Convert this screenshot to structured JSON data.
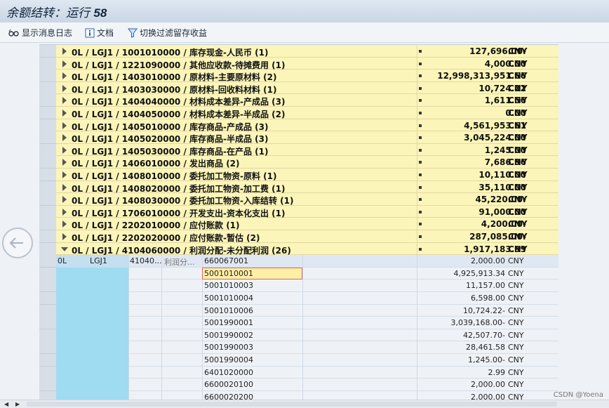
{
  "title": {
    "prefix": "余额结转：运行 ",
    "run": "58"
  },
  "toolbar": [
    {
      "label": "显示消息日志",
      "icon": "glasses-icon"
    },
    {
      "label": "文档",
      "icon": "info-icon"
    },
    {
      "label": "切换过滤留存收益",
      "icon": "filter-icon"
    }
  ],
  "groups": [
    {
      "text": "0L / LGJ1 / 1001010000 / 库存现金-人民币 (1)",
      "amount": "127,696.00-",
      "currency": "CNY"
    },
    {
      "text": "0L / LGJ1 / 1221090000 / 其他应收款-待摊费用 (1)",
      "amount": "4,000.00",
      "currency": "CNY"
    },
    {
      "text": "0L / LGJ1 / 1403010000 / 原材料-主要原材料 (2)",
      "amount": "12,998,313,951.66",
      "currency": "CNY"
    },
    {
      "text": "0L / LGJ1 / 1403030000 / 原材料-回收料材料 (1)",
      "amount": "10,724.22",
      "currency": "CNY"
    },
    {
      "text": "0L / LGJ1 / 1404040000 / 材料成本差异-产成品 (3)",
      "amount": "1,611.56",
      "currency": "CNY"
    },
    {
      "text": "0L / LGJ1 / 1404050000 / 材料成本差异-半成品 (2)",
      "amount": "0.00",
      "currency": "CNY"
    },
    {
      "text": "0L / LGJ1 / 1405010000 / 库存商品-产成品 (3)",
      "amount": "4,561,953.61",
      "currency": "CNY"
    },
    {
      "text": "0L / LGJ1 / 1405020000 / 库存商品-半成品 (3)",
      "amount": "3,045,224.00",
      "currency": "CNY"
    },
    {
      "text": "0L / LGJ1 / 1405030000 / 库存商品-在产品 (1)",
      "amount": "1,245.00",
      "currency": "CNY"
    },
    {
      "text": "0L / LGJ1 / 1406010000 / 发出商品 (2)",
      "amount": "7,686.96",
      "currency": "CNY"
    },
    {
      "text": "0L / LGJ1 / 1408010000 / 委托加工物资-原料 (1)",
      "amount": "10,110.00",
      "currency": "CNY"
    },
    {
      "text": "0L / LGJ1 / 1408020000 / 委托加工物资-加工费 (1)",
      "amount": "35,110.00",
      "currency": "CNY"
    },
    {
      "text": "0L / LGJ1 / 1408030000 / 委托加工物资-入库结转 (1)",
      "amount": "45,220.00-",
      "currency": "CNY"
    },
    {
      "text": "0L / LGJ1 / 1706010000 / 开发支出-资本化支出 (1)",
      "amount": "91,000.00",
      "currency": "CNY"
    },
    {
      "text": "0L / LGJ1 / 2202010000 / 应付账款 (1)",
      "amount": "4,200.00-",
      "currency": "CNY"
    },
    {
      "text": "0L / LGJ1 / 2202020000 / 应付账款-暂估 (2)",
      "amount": "287,085.00-",
      "currency": "CNY"
    },
    {
      "text": "0L / LGJ1 / 4104060000 / 利润分配-未分配利润 (26)",
      "amount": "1,917,183.99",
      "currency": "CNY",
      "expanded": true
    }
  ],
  "detail_head": {
    "ledger": "0L",
    "company": "LGJ1",
    "account": "41040...",
    "name": "利润分..."
  },
  "details": [
    {
      "account": "660067001",
      "amount": "2,000.00",
      "currency": "CNY"
    },
    {
      "account": "5001010001",
      "amount": "4,925,913.34",
      "currency": "CNY",
      "selected": true
    },
    {
      "account": "5001010003",
      "amount": "11,157.00",
      "currency": "CNY"
    },
    {
      "account": "5001010004",
      "amount": "6,598.00",
      "currency": "CNY"
    },
    {
      "account": "5001010006",
      "amount": "10,724.22-",
      "currency": "CNY"
    },
    {
      "account": "5001990001",
      "amount": "3,039,168.00-",
      "currency": "CNY"
    },
    {
      "account": "5001990002",
      "amount": "42,507.70-",
      "currency": "CNY"
    },
    {
      "account": "5001990003",
      "amount": "28,461.58",
      "currency": "CNY"
    },
    {
      "account": "5001990004",
      "amount": "1,245.00-",
      "currency": "CNY"
    },
    {
      "account": "6401020000",
      "amount": "2.99",
      "currency": "CNY"
    },
    {
      "account": "6600020100",
      "amount": "2,000.00",
      "currency": "CNY"
    },
    {
      "account": "6600020200",
      "amount": "2,000.00",
      "currency": "CNY"
    }
  ],
  "watermark": "CSDN @Yoena"
}
